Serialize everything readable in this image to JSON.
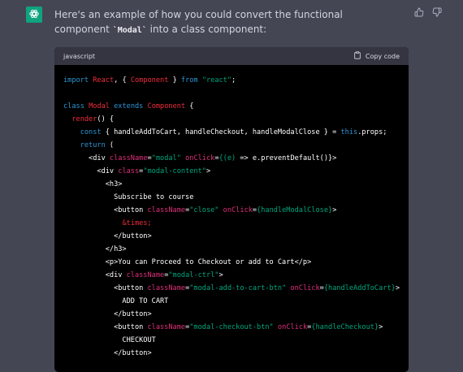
{
  "message": {
    "text_before": "Here's an example of how you could convert the functional component ",
    "code_inline": "`Modal`",
    "text_after": " into a class component:"
  },
  "code_block": {
    "language": "javascript",
    "copy_label": "Copy code",
    "lines": [
      [
        {
          "t": "import",
          "c": "kw"
        },
        {
          "t": " "
        },
        {
          "t": "React",
          "c": "cls"
        },
        {
          "t": ", { "
        },
        {
          "t": "Component",
          "c": "cls"
        },
        {
          "t": " } "
        },
        {
          "t": "from",
          "c": "kw"
        },
        {
          "t": " "
        },
        {
          "t": "\"react\"",
          "c": "str"
        },
        {
          "t": ";"
        }
      ],
      [],
      [
        {
          "t": "class",
          "c": "kw"
        },
        {
          "t": " "
        },
        {
          "t": "Modal",
          "c": "cls"
        },
        {
          "t": " "
        },
        {
          "t": "extends",
          "c": "kw"
        },
        {
          "t": " "
        },
        {
          "t": "Component",
          "c": "cls"
        },
        {
          "t": " {"
        }
      ],
      [
        {
          "t": "  "
        },
        {
          "t": "render",
          "c": "cls"
        },
        {
          "t": "() {"
        }
      ],
      [
        {
          "t": "    "
        },
        {
          "t": "const",
          "c": "kw"
        },
        {
          "t": " { handleAddToCart, handleCheckout, handleModalClose } = "
        },
        {
          "t": "this",
          "c": "kw"
        },
        {
          "t": ".props;"
        }
      ],
      [
        {
          "t": "    "
        },
        {
          "t": "return",
          "c": "kw"
        },
        {
          "t": " ("
        }
      ],
      [
        {
          "t": "      <div "
        },
        {
          "t": "className",
          "c": "attr"
        },
        {
          "t": "="
        },
        {
          "t": "\"modal\"",
          "c": "str"
        },
        {
          "t": " "
        },
        {
          "t": "onClick",
          "c": "attr"
        },
        {
          "t": "="
        },
        {
          "t": "{(e)",
          "c": "str"
        },
        {
          "t": " => e.preventDefault()}>"
        }
      ],
      [
        {
          "t": "        <div "
        },
        {
          "t": "class",
          "c": "attr"
        },
        {
          "t": "="
        },
        {
          "t": "\"modal-content\"",
          "c": "str"
        },
        {
          "t": ">"
        }
      ],
      [
        {
          "t": "          <h3>"
        }
      ],
      [
        {
          "t": "            Subscribe to course"
        }
      ],
      [
        {
          "t": "            <button "
        },
        {
          "t": "className",
          "c": "attr"
        },
        {
          "t": "="
        },
        {
          "t": "\"close\"",
          "c": "str"
        },
        {
          "t": " "
        },
        {
          "t": "onClick",
          "c": "attr"
        },
        {
          "t": "="
        },
        {
          "t": "{handleModalClose}",
          "c": "str"
        },
        {
          "t": ">"
        }
      ],
      [
        {
          "t": "              "
        },
        {
          "t": "&times;",
          "c": "cls"
        }
      ],
      [
        {
          "t": "            </button>"
        }
      ],
      [
        {
          "t": "          </h3>"
        }
      ],
      [
        {
          "t": "          <p>You can Proceed to Checkout or add to Cart</p>"
        }
      ],
      [
        {
          "t": "          <div "
        },
        {
          "t": "className",
          "c": "attr"
        },
        {
          "t": "="
        },
        {
          "t": "\"modal-ctrl\"",
          "c": "str"
        },
        {
          "t": ">"
        }
      ],
      [
        {
          "t": "            <button "
        },
        {
          "t": "className",
          "c": "attr"
        },
        {
          "t": "="
        },
        {
          "t": "\"modal-add-to-cart-btn\"",
          "c": "str"
        },
        {
          "t": " "
        },
        {
          "t": "onClick",
          "c": "attr"
        },
        {
          "t": "="
        },
        {
          "t": "{handleAddToCart}",
          "c": "str"
        },
        {
          "t": ">"
        }
      ],
      [
        {
          "t": "              ADD TO CART"
        }
      ],
      [
        {
          "t": "            </button>"
        }
      ],
      [
        {
          "t": "            <button "
        },
        {
          "t": "className",
          "c": "attr"
        },
        {
          "t": "="
        },
        {
          "t": "\"modal-checkout-btn\"",
          "c": "str"
        },
        {
          "t": " "
        },
        {
          "t": "onClick",
          "c": "attr"
        },
        {
          "t": "="
        },
        {
          "t": "{handleCheckout}",
          "c": "str"
        },
        {
          "t": ">"
        }
      ],
      [
        {
          "t": "              CHECKOUT"
        }
      ],
      [
        {
          "t": "            </button>"
        }
      ]
    ]
  },
  "colors": {
    "background": "#444654",
    "avatar": "#10a37f",
    "code_bg": "#000000",
    "code_header_bg": "#343541",
    "keyword": "#2e95d3",
    "class_name": "#f22c3d",
    "string": "#00a67d",
    "attribute": "#df3079"
  },
  "icons": {
    "avatar": "openai-logo-icon",
    "thumbs_up": "thumbs-up-icon",
    "thumbs_down": "thumbs-down-icon",
    "copy": "clipboard-icon"
  }
}
